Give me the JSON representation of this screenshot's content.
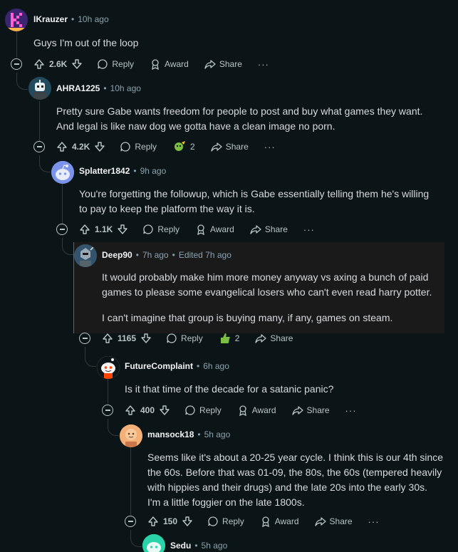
{
  "comments": [
    {
      "author": "IKrauzer",
      "age": "10h ago",
      "edited": "",
      "body": [
        "Guys I'm out of the loop"
      ],
      "votes": "2.6K",
      "reply": "Reply",
      "award": "Award",
      "share": "Share",
      "avatar_icon": "pixel-k-avatar-icon"
    },
    {
      "author": "AHRA1225",
      "age": "10h ago",
      "edited": "",
      "body": [
        "Pretty sure Gabe wants freedom for people to post and buy what games they want.",
        "And legal is like naw dog we gotta have a clean image no porn."
      ],
      "votes": "4.2K",
      "reply": "Reply",
      "award_count": "2",
      "share": "Share",
      "avatar_icon": "robot-avatar-icon"
    },
    {
      "author": "Splatter1842",
      "age": "9h ago",
      "edited": "",
      "body": [
        "You're forgetting the followup, which is Gabe essentially telling them he's willing",
        "to pay to keep the platform the way it is."
      ],
      "votes": "1.1K",
      "reply": "Reply",
      "award": "Award",
      "share": "Share",
      "avatar_icon": "snoo-default-avatar-icon"
    },
    {
      "author": "Deep90",
      "age": "7h ago",
      "edited": "Edited 7h ago",
      "body": [
        "It would probably make him more money anyway vs axing a bunch of paid",
        "games to please some evangelical losers who can't even read harry potter.",
        "I can't imagine that group is buying many, if any, games on steam."
      ],
      "votes": "1165",
      "reply": "Reply",
      "award_count": "2",
      "share": "Share",
      "avatar_icon": "armored-avatar-icon"
    },
    {
      "author": "FutureComplaint",
      "age": "6h ago",
      "edited": "",
      "body": [
        "Is it that time of the decade for a satanic panic?"
      ],
      "votes": "400",
      "reply": "Reply",
      "award": "Award",
      "share": "Share",
      "avatar_icon": "snoo-orange-avatar-icon"
    },
    {
      "author": "mansock18",
      "age": "5h ago",
      "edited": "",
      "body": [
        "Seems like it's about a 20-25 year cycle. I think this is our 4th since",
        "the 60s. Before that was 01-09, the 80s, the 60s (tempered heavily",
        "with hippies and their drugs) and the late 20s into the early 30s.",
        "I'm a little foggier on the late 1800s."
      ],
      "votes": "150",
      "reply": "Reply",
      "award": "Award",
      "share": "Share",
      "avatar_icon": "face-avatar-icon"
    },
    {
      "author": "Sedu",
      "age": "5h ago",
      "avatar_icon": "snoo-teal-avatar-icon"
    }
  ],
  "more_symbol": "···",
  "colors": {
    "background": "#0b1416",
    "highlight_border": "#d93a00",
    "meta": "#8ba2ad"
  }
}
